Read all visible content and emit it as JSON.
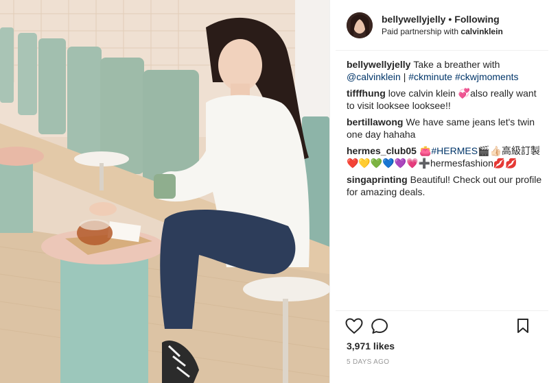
{
  "header": {
    "username": "bellywellyjelly",
    "separator": "•",
    "follow_status": "Following",
    "partnership_prefix": "Paid partnership with",
    "partner": "calvinklein"
  },
  "comments": [
    {
      "user": "bellywellyjelly",
      "text_parts": [
        {
          "text": "Take a breather with ",
          "tag": false
        },
        {
          "text": "@calvinklein",
          "tag": true
        },
        {
          "text": " | ",
          "tag": false
        },
        {
          "text": "#ckminute",
          "tag": true
        },
        {
          "text": " ",
          "tag": false
        },
        {
          "text": "#ckwjmoments",
          "tag": true
        }
      ]
    },
    {
      "user": "tifffhung",
      "text_parts": [
        {
          "text": "love calvin klein 💞also really want to visit looksee looksee!!",
          "tag": false
        }
      ]
    },
    {
      "user": "bertillawong",
      "text_parts": [
        {
          "text": "We have same jeans let's twin one day hahaha",
          "tag": false
        }
      ]
    },
    {
      "user": "hermes_club05",
      "text_parts": [
        {
          "text": "👛",
          "tag": false
        },
        {
          "text": "#HERMES",
          "tag": true
        },
        {
          "text": "🎬👍🏻高級訂製❤️💛💚💙💜💗➕hermesfashion💋💋",
          "tag": false
        }
      ]
    },
    {
      "user": "singaprinting",
      "text_parts": [
        {
          "text": "Beautiful! Check out our profile for amazing deals.",
          "tag": false
        }
      ]
    }
  ],
  "actions": {
    "like_icon": "heart-icon",
    "comment_icon": "comment-bubble-icon",
    "save_icon": "bookmark-icon"
  },
  "likes": "3,971 likes",
  "timestamp": "5 DAYS AGO",
  "colors": {
    "link": "#003569",
    "text": "#262626",
    "muted": "#999999",
    "divider": "#efefef"
  }
}
